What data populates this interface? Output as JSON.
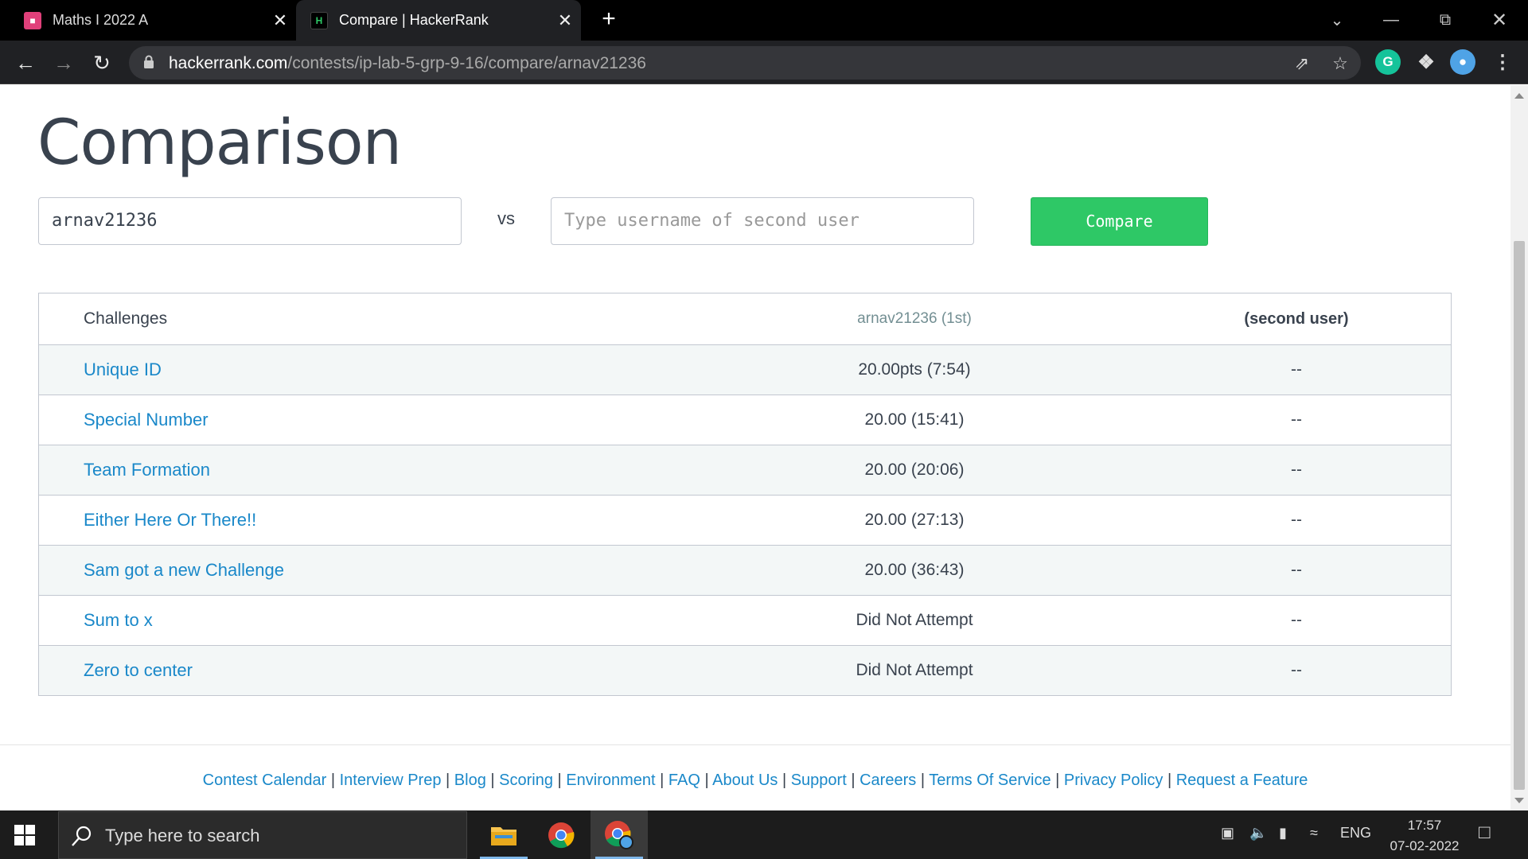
{
  "browser": {
    "tabs": [
      {
        "title": "Maths I 2022 A"
      },
      {
        "title": "Compare | HackerRank"
      }
    ],
    "url_host": "hackerrank.com",
    "url_path": "/contests/ip-lab-5-grp-9-16/compare/arnav21236"
  },
  "page": {
    "heading": "Comparison",
    "user1_value": "arnav21236",
    "vs_label": "vs",
    "user2_placeholder": "Type username of second user",
    "compare_label": "Compare",
    "table": {
      "headers": [
        "Challenges",
        "arnav21236 (1st)",
        "(second user)"
      ],
      "rows": [
        {
          "challenge": "Unique ID",
          "user1": "20.00pts (7:54)",
          "user2": "--"
        },
        {
          "challenge": "Special Number",
          "user1": "20.00 (15:41)",
          "user2": "--"
        },
        {
          "challenge": "Team Formation",
          "user1": "20.00 (20:06)",
          "user2": "--"
        },
        {
          "challenge": "Either Here Or There!!",
          "user1": "20.00 (27:13)",
          "user2": "--"
        },
        {
          "challenge": "Sam got a new Challenge",
          "user1": "20.00 (36:43)",
          "user2": "--"
        },
        {
          "challenge": "Sum to x",
          "user1": "Did Not Attempt",
          "user2": "--"
        },
        {
          "challenge": "Zero to center",
          "user1": "Did Not Attempt",
          "user2": "--"
        }
      ]
    },
    "footer_links": [
      "Contest Calendar",
      "Interview Prep",
      "Blog",
      "Scoring",
      "Environment",
      "FAQ",
      "About Us",
      "Support",
      "Careers",
      "Terms Of Service",
      "Privacy Policy",
      "Request a Feature"
    ],
    "footer_separator": "|"
  },
  "taskbar": {
    "search_placeholder": "Type here to search",
    "language": "ENG",
    "time": "17:57",
    "date": "07-02-2022"
  },
  "colors": {
    "accent_green": "#2ec866",
    "link_blue": "#1a88c9",
    "text_dark": "#39424e"
  }
}
